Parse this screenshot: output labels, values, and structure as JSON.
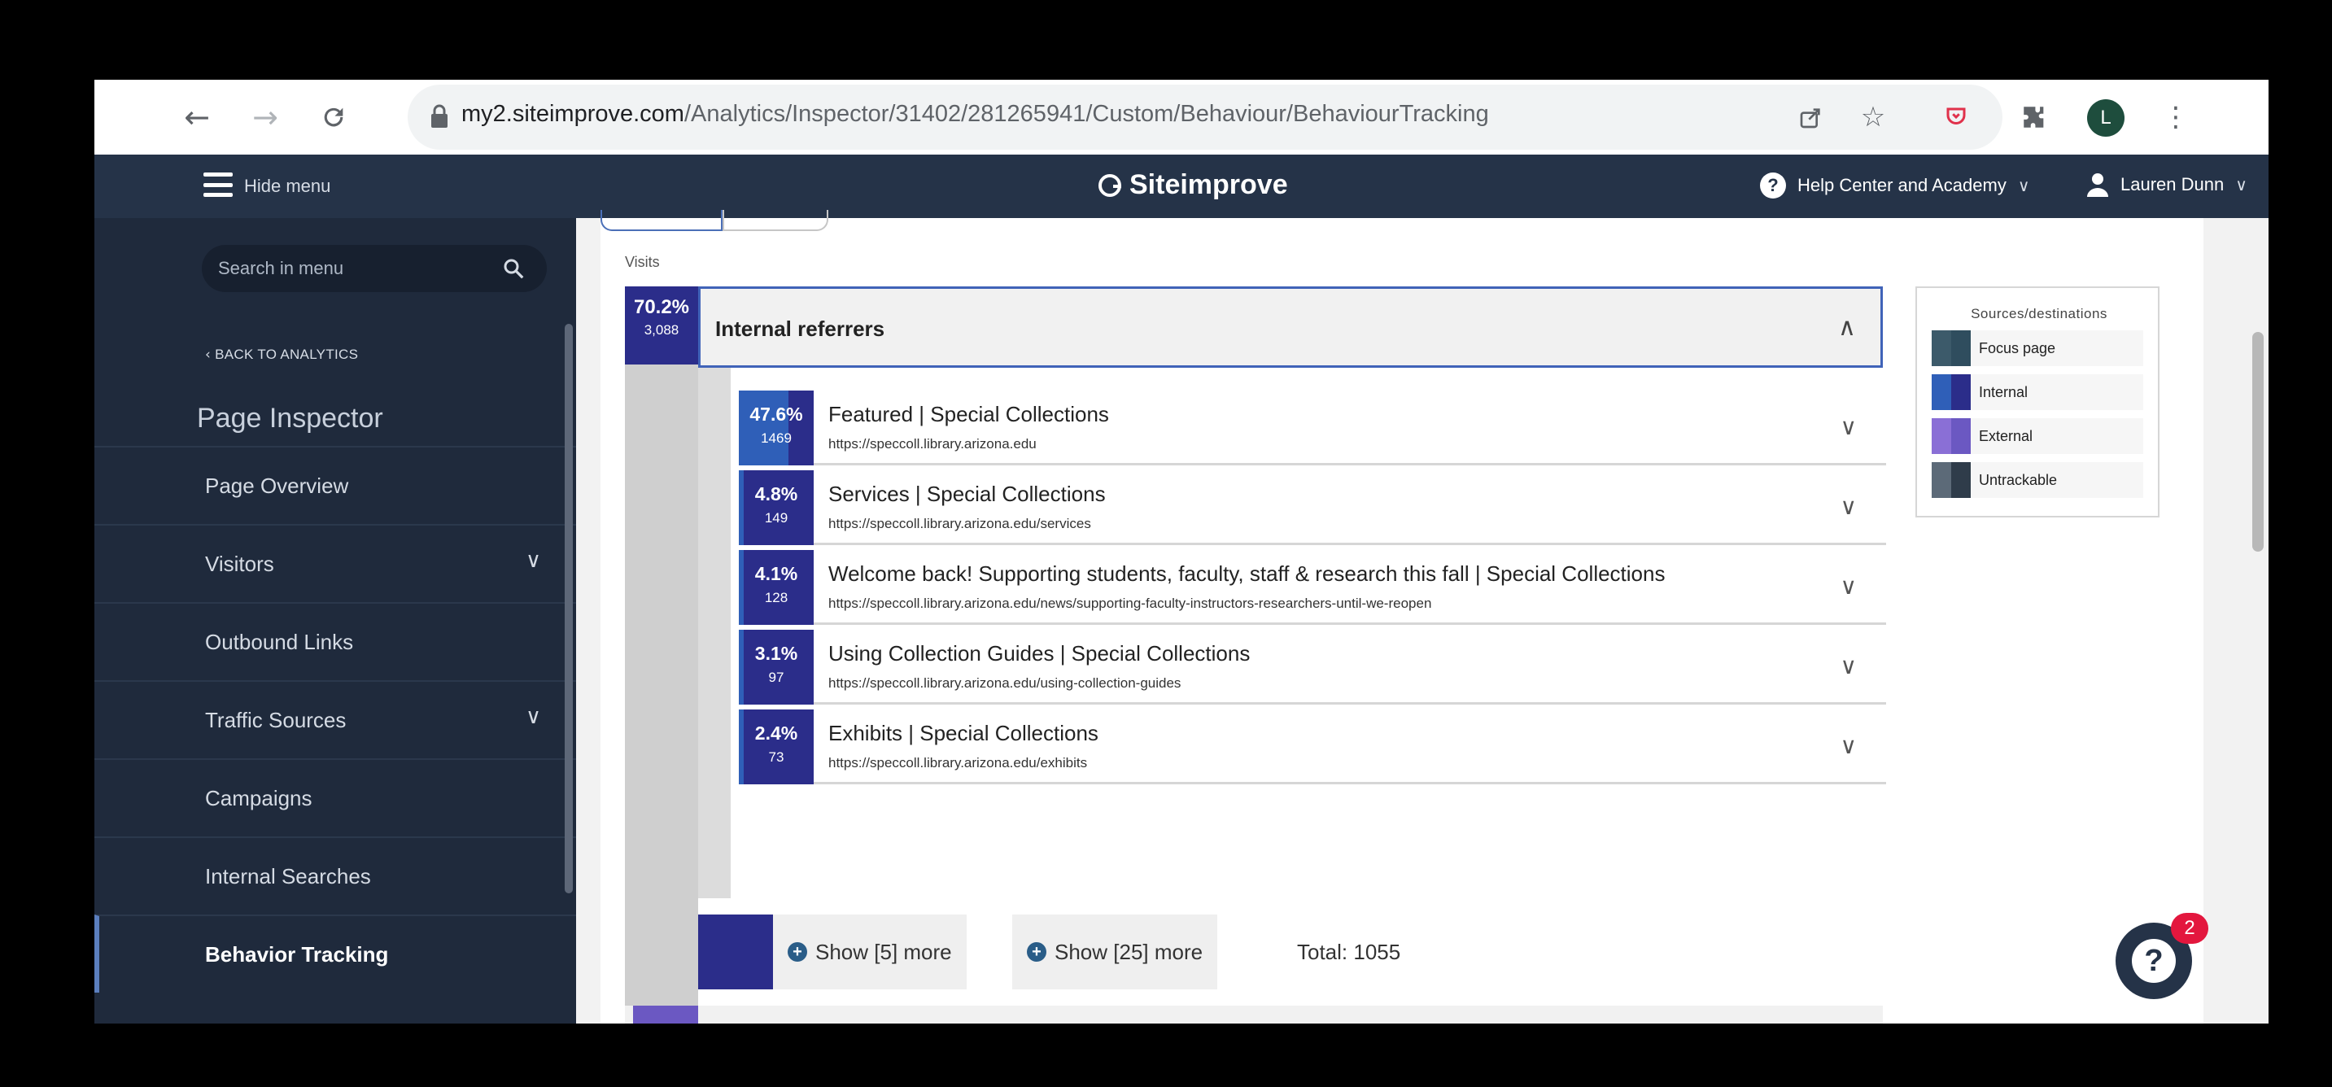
{
  "browser": {
    "url_host": "my2.siteimprove.com",
    "url_path": "/Analytics/Inspector/31402/281265941/Custom/Behaviour/BehaviourTracking",
    "profile_initial": "L"
  },
  "topbar": {
    "hide_menu": "Hide menu",
    "brand": "Siteimprove",
    "help": "Help Center and Academy",
    "user": "Lauren Dunn"
  },
  "sidebar": {
    "search_placeholder": "Search in menu",
    "back": "BACK TO ANALYTICS",
    "title": "Page Inspector",
    "items": [
      {
        "label": "Page Overview"
      },
      {
        "label": "Visitors"
      },
      {
        "label": "Outbound Links"
      },
      {
        "label": "Traffic Sources"
      },
      {
        "label": "Campaigns"
      },
      {
        "label": "Internal Searches"
      },
      {
        "label": "Behavior Tracking"
      }
    ]
  },
  "main": {
    "visits_label": "Visits",
    "main_badge": {
      "pct": "70.2%",
      "count": "3,088"
    },
    "group_title": "Internal referrers",
    "rows": [
      {
        "pct": "47.6%",
        "count": "1469",
        "share": 0.476,
        "title": "Featured | Special Collections",
        "url": "https://speccoll.library.arizona.edu"
      },
      {
        "pct": "4.8%",
        "count": "149",
        "share": 0.048,
        "title": "Services | Special Collections",
        "url": "https://speccoll.library.arizona.edu/services"
      },
      {
        "pct": "4.1%",
        "count": "128",
        "share": 0.041,
        "title": "Welcome back! Supporting students, faculty, staff & research this fall | Special Collections",
        "url": "https://speccoll.library.arizona.edu/news/supporting-faculty-instructors-researchers-until-we-reopen"
      },
      {
        "pct": "3.1%",
        "count": "97",
        "share": 0.031,
        "title": "Using Collection Guides | Special Collections",
        "url": "https://speccoll.library.arizona.edu/using-collection-guides"
      },
      {
        "pct": "2.4%",
        "count": "73",
        "share": 0.024,
        "title": "Exhibits | Special Collections",
        "url": "https://speccoll.library.arizona.edu/exhibits"
      }
    ],
    "show_more_5": "Show [5] more",
    "show_more_25": "Show [25] more",
    "total": "Total: 1055"
  },
  "legend": {
    "title": "Sources/destinations",
    "items": [
      {
        "label": "Focus page",
        "color_a": "#3c5a6a",
        "color_b": "#2f4d5e"
      },
      {
        "label": "Internal",
        "color_a": "#2f5fb8",
        "color_b": "#2b2d8a"
      },
      {
        "label": "External",
        "color_a": "#8a6fd6",
        "color_b": "#6b58c2"
      },
      {
        "label": "Untrackable",
        "color_a": "#5c6a78",
        "color_b": "#2f3c4a"
      }
    ]
  },
  "help_widget": {
    "badge": "2"
  }
}
